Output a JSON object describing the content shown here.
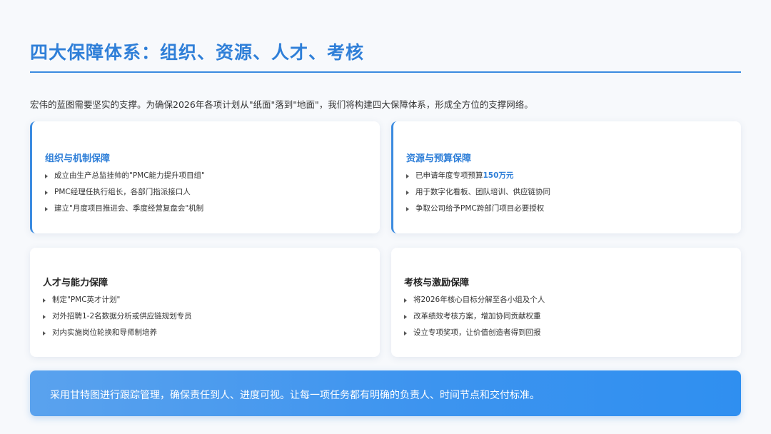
{
  "slide": {
    "title": "四大保障体系：组织、资源、人才、考核",
    "intro": "宏伟的蓝图需要坚实的支撑。为确保2026年各项计划从\"纸面\"落到\"地面\"，我们将构建四大保障体系，形成全方位的支撑网络。"
  },
  "cards": {
    "org": {
      "title": "组织与机制保障",
      "items": [
        "成立由生产总监挂帅的\"PMC能力提升项目组\"",
        "PMC经理任执行组长，各部门指派接口人",
        "建立\"月度项目推进会、季度经营复盘会\"机制"
      ]
    },
    "resource": {
      "title": "资源与预算保障",
      "item0_prefix": "已申请年度专项预算",
      "item0_highlight": "150万元",
      "items": [
        "用于数字化看板、团队培训、供应链协同",
        "争取公司给予PMC跨部门项目必要授权"
      ]
    },
    "talent": {
      "title": "人才与能力保障",
      "items": [
        "制定\"PMC英才计划\"",
        "对外招聘1-2名数据分析或供应链规划专员",
        "对内实施岗位轮换和导师制培养"
      ]
    },
    "assessment": {
      "title": "考核与激励保障",
      "items": [
        "将2026年核心目标分解至各小组及个人",
        "改革绩效考核方案，增加协同贡献权重",
        "设立专项奖项，让价值创造者得到回报"
      ]
    }
  },
  "banner": {
    "text": "采用甘特图进行跟踪管理，确保责任到人、进度可视。让每一项任务都有明确的负责人、时间节点和交付标准。"
  },
  "colors": {
    "accent": "#2f7fd8",
    "banner_start": "#5aa2ee",
    "banner_end": "#2f8ff0"
  }
}
